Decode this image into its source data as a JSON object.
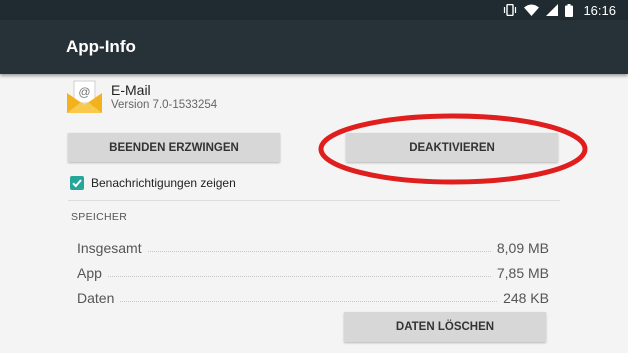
{
  "status_bar": {
    "time": "16:16",
    "icons": [
      "vibrate-icon",
      "wifi-icon",
      "signal-icon",
      "battery-icon"
    ]
  },
  "app_bar": {
    "title": "App-Info"
  },
  "app": {
    "name": "E-Mail",
    "version": "Version 7.0-1533254",
    "icon": "email-envelope-icon"
  },
  "buttons": {
    "force_stop": "BEENDEN ERZWINGEN",
    "disable": "DEAKTIVIEREN",
    "clear_data": "DATEN LÖSCHEN"
  },
  "notifications": {
    "label": "Benachrichtigungen zeigen",
    "checked": true
  },
  "storage": {
    "header": "SPEICHER",
    "rows": [
      {
        "label": "Insgesamt",
        "value": "8,09 MB"
      },
      {
        "label": "App",
        "value": "7,85 MB"
      },
      {
        "label": "Daten",
        "value": "248 KB"
      }
    ]
  },
  "colors": {
    "status_bar": "#1f2b30",
    "app_bar": "#263238",
    "accent": "#26a69a",
    "highlight": "#e01e1e",
    "button": "#d7d7d7"
  }
}
